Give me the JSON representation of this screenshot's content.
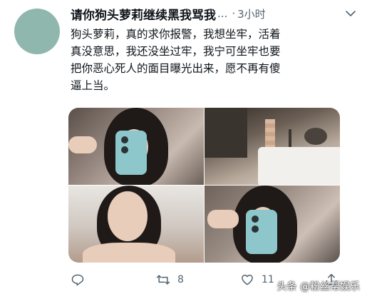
{
  "tweet": {
    "author_name": "请你狗头萝莉继续黑我骂我",
    "ellipsis": "...",
    "separator": "·",
    "timestamp": "3小时",
    "text_lines": [
      "狗头萝莉，真的求你报警，我想坐牢，活着",
      "真没意思，我还没坐过牢，我宁可坐牢也要",
      "把你恶心死人的面目曝光出来，愿不再有傻",
      "逼上当。"
    ],
    "avatar_color": "#8fb7ad"
  },
  "media": {
    "photos": [
      {
        "name": "mirror-selfie-1",
        "subject": "mirror selfie with teal phone"
      },
      {
        "name": "bedroom-photo",
        "subject": "bedroom with bed, mosaic-blurred area"
      },
      {
        "name": "winking-selfie",
        "subject": "selfie winking"
      },
      {
        "name": "mirror-selfie-2",
        "subject": "mirror selfie with teal phone"
      }
    ]
  },
  "actions": {
    "reply_icon": "reply-icon",
    "retweet_icon": "retweet-icon",
    "retweet_count": "8",
    "like_icon": "heart-icon",
    "like_count": "11",
    "share_icon": "share-icon"
  },
  "watermark": "头条 @粉丝帮娱乐",
  "colors": {
    "text_primary": "#0f1419",
    "text_secondary": "#536471",
    "background": "#ffffff"
  }
}
